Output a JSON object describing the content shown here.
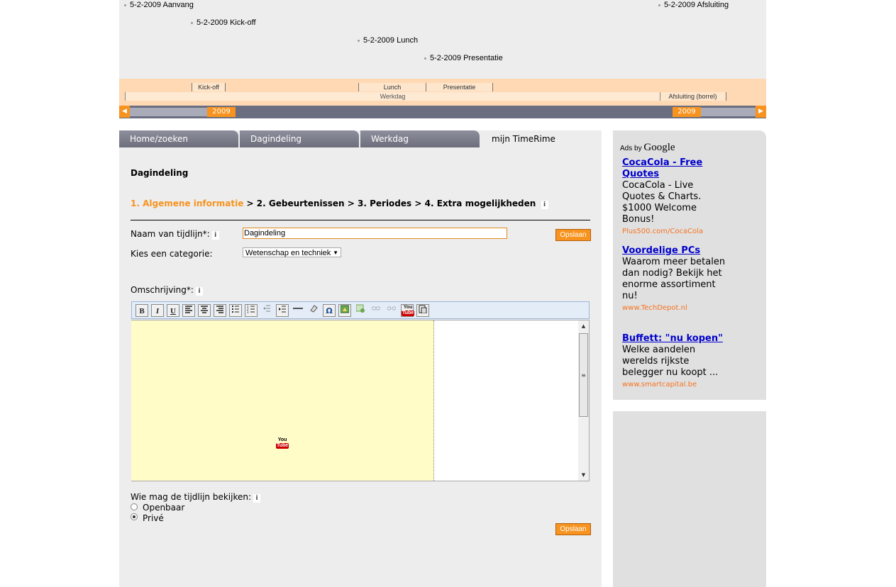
{
  "timeline": {
    "events": [
      {
        "label": "5-2-2009 Aanvang"
      },
      {
        "label": "5-2-2009 Kick-off"
      },
      {
        "label": "5-2-2009 Lunch"
      },
      {
        "label": "5-2-2009 Presentatie"
      },
      {
        "label": "5-2-2009 Afsluiting"
      }
    ],
    "periods": {
      "kickoff": "Kick-off",
      "lunch": "Lunch",
      "presentatie": "Presentatie",
      "afsluiting": "Afsluiting (borrel)",
      "werkdag": "Werkdag"
    },
    "year_left": "2009",
    "year_right": "2009"
  },
  "tabs": [
    {
      "label": "Home/zoeken"
    },
    {
      "label": "Dagindeling"
    },
    {
      "label": "Werkdag"
    },
    {
      "label": "mijn TimeRime"
    }
  ],
  "page_title": "Dagindeling",
  "steps": {
    "step1": "1. Algemene informatie",
    "sep": ">",
    "step2": "2. Gebeurtenissen",
    "step3": "3. Periodes",
    "step4": "4. Extra mogelijkheden",
    "info": "i"
  },
  "form": {
    "name_label": "Naam van tijdlijn*:",
    "name_value": "Dagindeling",
    "save_label": "Opslaan",
    "category_label": "Kies een categorie:",
    "category_value": "Wetenschap en techniek",
    "description_label": "Omschrijving*:",
    "visibility_label": "Wie mag de tijdlijn bekijken:",
    "option_public": "Openbaar",
    "option_private": "Privé",
    "selected_visibility": "Privé"
  },
  "toolbar": {
    "bold": "B",
    "italic": "I",
    "underline": "U",
    "omega": "Ω",
    "youtube_top": "You",
    "youtube_bottom": "Tube"
  },
  "ads": {
    "header_small": "Ads by",
    "header_brand": "Google",
    "items": [
      {
        "title": "CocaCola - Free Quotes",
        "body": "CocaCola - Live Quotes & Charts. $1000 Welcome Bonus!",
        "url": "Plus500.com/CocaCola"
      },
      {
        "title": "Voordelige PCs",
        "body": "Waarom meer betalen dan nodig? Bekijk het enorme assortiment nu!",
        "url": "www.TechDepot.nl"
      },
      {
        "title": "Buffett: \"nu kopen\"",
        "body": "Welke aandelen werelds rijkste belegger nu koopt ...",
        "url": "www.smartcapital.be"
      }
    ]
  },
  "colors": {
    "accent": "#f7931e",
    "timeline_band": "#fed9b3",
    "tab_bg": "#7d7e8c",
    "ad_link": "#0000cc"
  }
}
